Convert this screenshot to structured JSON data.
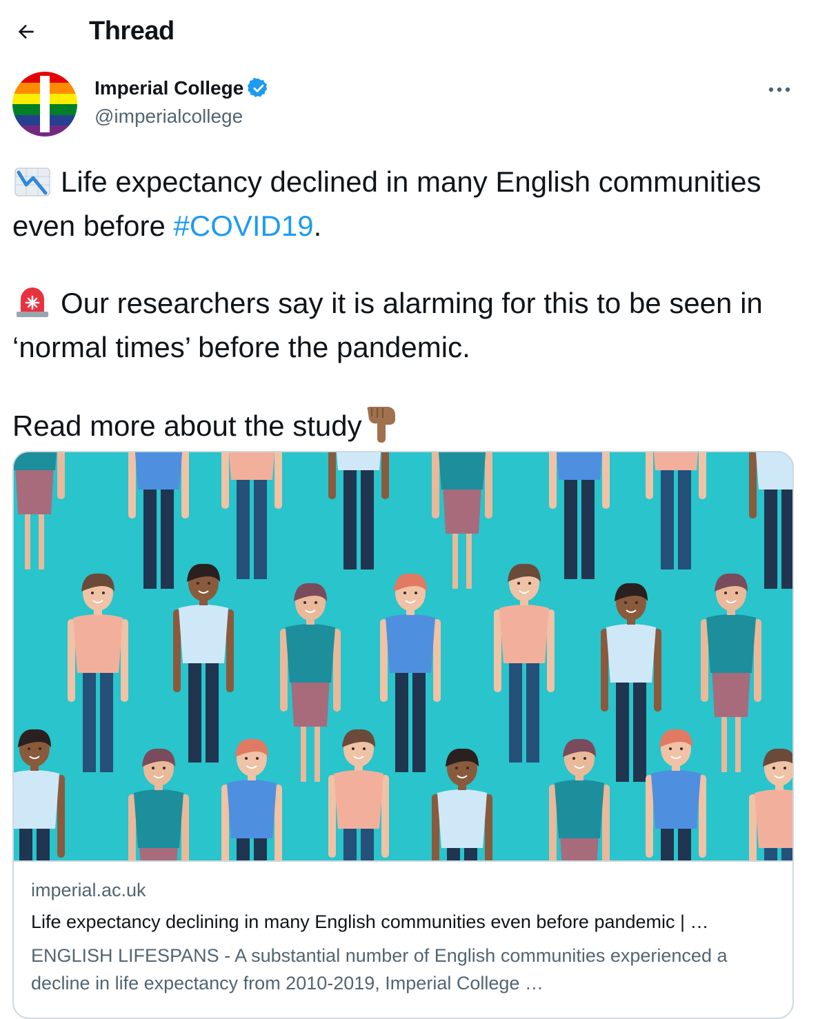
{
  "header": {
    "title": "Thread",
    "back_icon": "arrow-left-icon"
  },
  "author": {
    "name": "Imperial College",
    "handle": "@imperialcollege",
    "verified": true,
    "avatar_icon": "rainbow-logo"
  },
  "tweet": {
    "line1_pre": "Life expectancy declined in many English communities even before ",
    "hashtag": "#COVID19",
    "line1_post": ".",
    "line2": "Our researchers say it is alarming for this to be seen in ‘normal times’ before the pandemic.",
    "line3": "Read more about the study",
    "emoji1": "chart-decreasing-icon",
    "emoji2": "police-light-icon",
    "emoji3": "pointing-down-icon"
  },
  "card": {
    "domain": "imperial.ac.uk",
    "title": "Life expectancy declining in many English communities even before pandemic | …",
    "description": "ENGLISH LIFESPANS - A substantial number of English communities experienced a decline in life expectancy from 2010-2019, Imperial College …",
    "image_background": "#29c4cc"
  },
  "colors": {
    "link": "#1d9bf0",
    "secondary_text": "#536471",
    "border": "#cfd9de"
  }
}
